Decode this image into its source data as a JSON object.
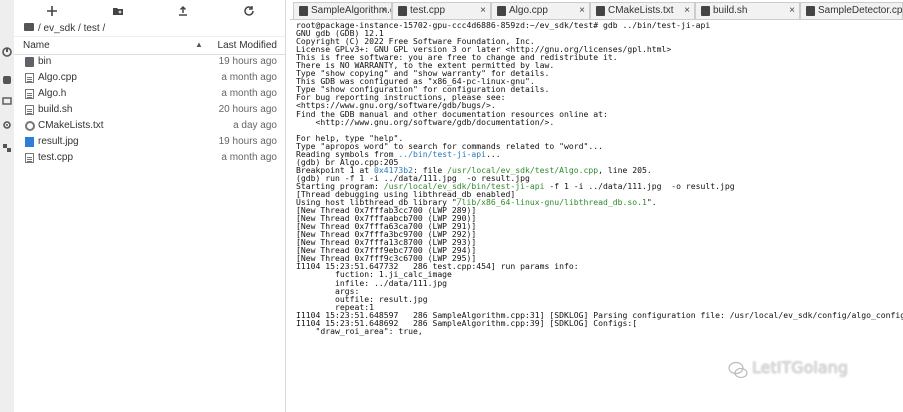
{
  "toolbar": {
    "new_launcher_icon": "plus-icon",
    "new_folder_icon": "folder-plus-icon",
    "upload_icon": "upload-icon",
    "refresh_icon": "refresh-icon"
  },
  "breadcrumb": "/ ev_sdk / test /",
  "columns": {
    "name": "Name",
    "modified": "Last Modified",
    "sort_indicator": "▲"
  },
  "files": [
    {
      "name": "bin",
      "modified": "19 hours ago",
      "icon": "folder-icon"
    },
    {
      "name": "Algo.cpp",
      "modified": "a month ago",
      "icon": "file-icon"
    },
    {
      "name": "Algo.h",
      "modified": "a month ago",
      "icon": "file-icon"
    },
    {
      "name": "build.sh",
      "modified": "20 hours ago",
      "icon": "file-icon"
    },
    {
      "name": "CMakeLists.txt",
      "modified": "a day ago",
      "icon": "settings-file-icon"
    },
    {
      "name": "result.jpg",
      "modified": "19 hours ago",
      "icon": "image-icon"
    },
    {
      "name": "test.cpp",
      "modified": "a month ago",
      "icon": "file-icon"
    }
  ],
  "tabs": [
    {
      "label": "SampleAlgorithm.c",
      "close": "×"
    },
    {
      "label": "test.cpp",
      "close": "×"
    },
    {
      "label": "Algo.cpp",
      "close": "×"
    },
    {
      "label": "CMakeLists.txt",
      "close": "×"
    },
    {
      "label": "build.sh",
      "close": "×"
    },
    {
      "label": "SampleDetector.cp",
      "close": ""
    }
  ],
  "terminal": {
    "l01": "root@package-instance-15702-gpu-ccc4d6886-859zd:~/ev_sdk/test# gdb ../bin/test-ji-api",
    "l02": "GNU gdb (GDB) 12.1",
    "l03": "Copyright (C) 2022 Free Software Foundation, Inc.",
    "l04": "License GPLv3+: GNU GPL version 3 or later <http://gnu.org/licenses/gpl.html>",
    "l05": "This is free software: you are free to change and redistribute it.",
    "l06": "There is NO WARRANTY, to the extent permitted by law.",
    "l07": "Type \"show copying\" and \"show warranty\" for details.",
    "l08": "This GDB was configured as \"x86_64-pc-linux-gnu\".",
    "l09": "Type \"show configuration\" for configuration details.",
    "l10": "For bug reporting instructions, please see:",
    "l11": "<https://www.gnu.org/software/gdb/bugs/>.",
    "l12": "Find the GDB manual and other documentation resources online at:",
    "l13": "    <http://www.gnu.org/software/gdb/documentation/>.",
    "l14": "",
    "l15": "For help, type \"help\".",
    "l16": "Type \"apropos word\" to search for commands related to \"word\"...",
    "l17a": "Reading symbols from ",
    "l17b": "../bin/test-ji-api",
    "l17c": "...",
    "l18": "(gdb) br Algo.cpp:205",
    "l19a": "Breakpoint 1 at ",
    "l19b": "0x4173b2",
    "l19c": ": file ",
    "l19d": "/usr/local/ev_sdk/test/Algo.cpp",
    "l19e": ", line 205.",
    "l20": "(gdb) run -f 1 -i ../data/111.jpg  -o result.jpg",
    "l21a": "Starting program: ",
    "l21b": "/usr/local/ev_sdk/bin/test-ji-api",
    "l21c": " -f 1 -i ../data/111.jpg  -o result.jpg",
    "l22": "[Thread debugging using libthread_db enabled]",
    "l23a": "Using host libthread_db library \"",
    "l23b": "/lib/x86_64-linux-gnu/libthread_db.so.1",
    "l23c": "\".",
    "l24": "[New Thread 0x7fffab3cc700 (LWP 289)]",
    "l25": "[New Thread 0x7fffaabcb700 (LWP 290)]",
    "l26": "[New Thread 0x7fffa63ca700 (LWP 291)]",
    "l27": "[New Thread 0x7fffa3bc9700 (LWP 292)]",
    "l28": "[New Thread 0x7fffa13c8700 (LWP 293)]",
    "l29": "[New Thread 0x7fff9ebc7700 (LWP 294)]",
    "l30": "[New Thread 0x7fff9c3c6700 (LWP 295)]",
    "l31": "I1104 15:23:51.647732   286 test.cpp:454] run params info:",
    "l32": "        fuction: 1.ji_calc_image",
    "l33": "        infile: ../data/111.jpg",
    "l34": "        args:",
    "l35": "        outfile: result.jpg",
    "l36": "        repeat:1",
    "l37": "I1104 15:23:51.648597   286 SampleAlgorithm.cpp:31] [SDKLOG] Parsing configuration file: /usr/local/ev_sdk/config/algo_config.json",
    "l38": "I1104 15:23:51.648692   286 SampleAlgorithm.cpp:39] [SDKLOG] Configs:[",
    "l39": "    \"draw_roi_area\": true,"
  },
  "watermark": {
    "text": "LetITGolang",
    "icon": "wechat-icon"
  }
}
